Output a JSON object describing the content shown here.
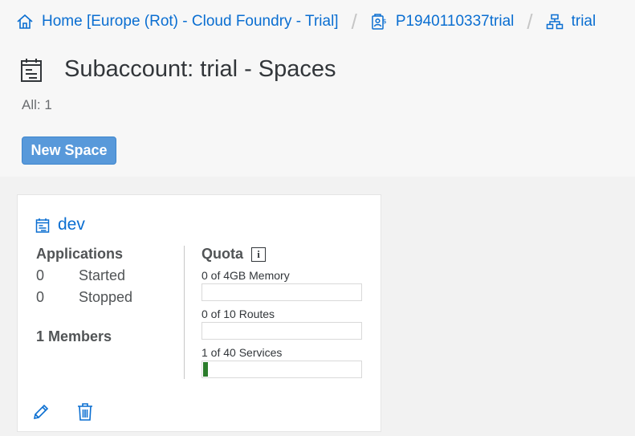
{
  "breadcrumb": {
    "home": "Home [Europe (Rot) - Cloud Foundry - Trial]",
    "global_account": "P1940110337trial",
    "subaccount": "trial"
  },
  "page": {
    "title": "Subaccount: trial - Spaces",
    "count": "All: 1",
    "new_space_label": "New Space"
  },
  "space": {
    "name": "dev",
    "applications": {
      "heading": "Applications",
      "started_count": "0",
      "started_label": "Started",
      "stopped_count": "0",
      "stopped_label": "Stopped"
    },
    "members": "1 Members",
    "quota": {
      "heading": "Quota",
      "info_glyph": "i",
      "items": [
        {
          "label": "0 of 4GB Memory",
          "fraction": 0
        },
        {
          "label": "0 of 10 Routes",
          "fraction": 0
        },
        {
          "label": "1 of 40 Services",
          "fraction": 0.025
        }
      ]
    }
  },
  "colors": {
    "link": "#0a6ed1",
    "button": "#5899da",
    "quota_fill": "#2b7c2b"
  }
}
